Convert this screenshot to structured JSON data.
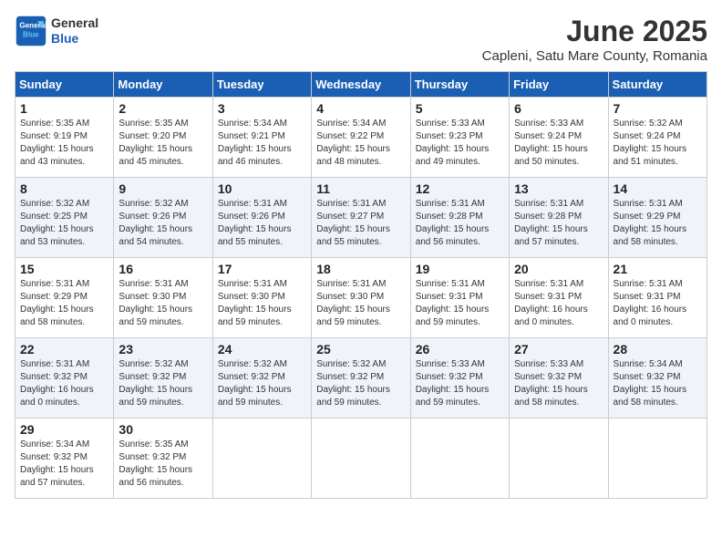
{
  "header": {
    "logo_line1": "General",
    "logo_line2": "Blue",
    "month": "June 2025",
    "location": "Capleni, Satu Mare County, Romania"
  },
  "weekdays": [
    "Sunday",
    "Monday",
    "Tuesday",
    "Wednesday",
    "Thursday",
    "Friday",
    "Saturday"
  ],
  "weeks": [
    [
      {
        "day": "1",
        "detail": "Sunrise: 5:35 AM\nSunset: 9:19 PM\nDaylight: 15 hours\nand 43 minutes."
      },
      {
        "day": "2",
        "detail": "Sunrise: 5:35 AM\nSunset: 9:20 PM\nDaylight: 15 hours\nand 45 minutes."
      },
      {
        "day": "3",
        "detail": "Sunrise: 5:34 AM\nSunset: 9:21 PM\nDaylight: 15 hours\nand 46 minutes."
      },
      {
        "day": "4",
        "detail": "Sunrise: 5:34 AM\nSunset: 9:22 PM\nDaylight: 15 hours\nand 48 minutes."
      },
      {
        "day": "5",
        "detail": "Sunrise: 5:33 AM\nSunset: 9:23 PM\nDaylight: 15 hours\nand 49 minutes."
      },
      {
        "day": "6",
        "detail": "Sunrise: 5:33 AM\nSunset: 9:24 PM\nDaylight: 15 hours\nand 50 minutes."
      },
      {
        "day": "7",
        "detail": "Sunrise: 5:32 AM\nSunset: 9:24 PM\nDaylight: 15 hours\nand 51 minutes."
      }
    ],
    [
      {
        "day": "8",
        "detail": "Sunrise: 5:32 AM\nSunset: 9:25 PM\nDaylight: 15 hours\nand 53 minutes."
      },
      {
        "day": "9",
        "detail": "Sunrise: 5:32 AM\nSunset: 9:26 PM\nDaylight: 15 hours\nand 54 minutes."
      },
      {
        "day": "10",
        "detail": "Sunrise: 5:31 AM\nSunset: 9:26 PM\nDaylight: 15 hours\nand 55 minutes."
      },
      {
        "day": "11",
        "detail": "Sunrise: 5:31 AM\nSunset: 9:27 PM\nDaylight: 15 hours\nand 55 minutes."
      },
      {
        "day": "12",
        "detail": "Sunrise: 5:31 AM\nSunset: 9:28 PM\nDaylight: 15 hours\nand 56 minutes."
      },
      {
        "day": "13",
        "detail": "Sunrise: 5:31 AM\nSunset: 9:28 PM\nDaylight: 15 hours\nand 57 minutes."
      },
      {
        "day": "14",
        "detail": "Sunrise: 5:31 AM\nSunset: 9:29 PM\nDaylight: 15 hours\nand 58 minutes."
      }
    ],
    [
      {
        "day": "15",
        "detail": "Sunrise: 5:31 AM\nSunset: 9:29 PM\nDaylight: 15 hours\nand 58 minutes."
      },
      {
        "day": "16",
        "detail": "Sunrise: 5:31 AM\nSunset: 9:30 PM\nDaylight: 15 hours\nand 59 minutes."
      },
      {
        "day": "17",
        "detail": "Sunrise: 5:31 AM\nSunset: 9:30 PM\nDaylight: 15 hours\nand 59 minutes."
      },
      {
        "day": "18",
        "detail": "Sunrise: 5:31 AM\nSunset: 9:30 PM\nDaylight: 15 hours\nand 59 minutes."
      },
      {
        "day": "19",
        "detail": "Sunrise: 5:31 AM\nSunset: 9:31 PM\nDaylight: 15 hours\nand 59 minutes."
      },
      {
        "day": "20",
        "detail": "Sunrise: 5:31 AM\nSunset: 9:31 PM\nDaylight: 16 hours\nand 0 minutes."
      },
      {
        "day": "21",
        "detail": "Sunrise: 5:31 AM\nSunset: 9:31 PM\nDaylight: 16 hours\nand 0 minutes."
      }
    ],
    [
      {
        "day": "22",
        "detail": "Sunrise: 5:31 AM\nSunset: 9:32 PM\nDaylight: 16 hours\nand 0 minutes."
      },
      {
        "day": "23",
        "detail": "Sunrise: 5:32 AM\nSunset: 9:32 PM\nDaylight: 15 hours\nand 59 minutes."
      },
      {
        "day": "24",
        "detail": "Sunrise: 5:32 AM\nSunset: 9:32 PM\nDaylight: 15 hours\nand 59 minutes."
      },
      {
        "day": "25",
        "detail": "Sunrise: 5:32 AM\nSunset: 9:32 PM\nDaylight: 15 hours\nand 59 minutes."
      },
      {
        "day": "26",
        "detail": "Sunrise: 5:33 AM\nSunset: 9:32 PM\nDaylight: 15 hours\nand 59 minutes."
      },
      {
        "day": "27",
        "detail": "Sunrise: 5:33 AM\nSunset: 9:32 PM\nDaylight: 15 hours\nand 58 minutes."
      },
      {
        "day": "28",
        "detail": "Sunrise: 5:34 AM\nSunset: 9:32 PM\nDaylight: 15 hours\nand 58 minutes."
      }
    ],
    [
      {
        "day": "29",
        "detail": "Sunrise: 5:34 AM\nSunset: 9:32 PM\nDaylight: 15 hours\nand 57 minutes."
      },
      {
        "day": "30",
        "detail": "Sunrise: 5:35 AM\nSunset: 9:32 PM\nDaylight: 15 hours\nand 56 minutes."
      },
      {
        "day": "",
        "detail": ""
      },
      {
        "day": "",
        "detail": ""
      },
      {
        "day": "",
        "detail": ""
      },
      {
        "day": "",
        "detail": ""
      },
      {
        "day": "",
        "detail": ""
      }
    ]
  ]
}
